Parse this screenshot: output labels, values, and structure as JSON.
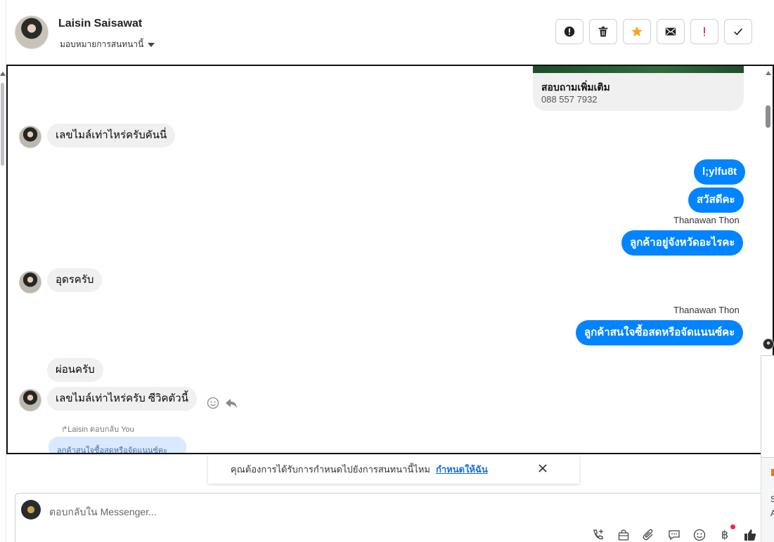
{
  "header": {
    "contact_name": "Laisin Saisawat",
    "assign_label": "มอบหมายการสนทนานี้"
  },
  "header_actions": [
    {
      "icon": "alert-circle-icon"
    },
    {
      "icon": "trash-icon"
    },
    {
      "icon": "star-icon",
      "color": "#f5a623"
    },
    {
      "icon": "mail-icon"
    },
    {
      "icon": "exclamation-icon",
      "color": "#e0245e"
    },
    {
      "icon": "check-icon"
    }
  ],
  "card": {
    "title": "สอบถามเพิ่มเติม",
    "phone": "088 557 7932"
  },
  "messages": {
    "m1": "เลขไมล์เท่าไหร่ครับคันนี่",
    "m2": "l;ylfu8t",
    "m3": "สวัสดีคะ",
    "m4_sender": "Thanawan Thon",
    "m4": "ลูกค้าอยู่จังหวัดอะไรคะ",
    "m5": "อุดรครับ",
    "m6_sender": "Thanawan Thon",
    "m6": "ลูกค้าสนใจซื้อสดหรือจัดแนนซ์คะ",
    "m7": "ผ่อนครับ",
    "m8": "เลขไมล์เท่าไหร่ครับ ซีวิคตัวนี้",
    "reply_note": "Laisin ตอบกลับ You",
    "quoted": "ลูกค้าสนใจซื้อสดหรือจัดแนนซ์คะ"
  },
  "notification": {
    "text": "คุณต้องการได้รับการกำหนดไปยังการสนทนานี้ไหม",
    "link": "กำหนดให้ฉัน"
  },
  "composer": {
    "placeholder": "ตอบกลับใน Messenger...",
    "baht_symbol": "฿"
  },
  "edge": {
    "s": "S",
    "a": "A"
  },
  "colors": {
    "outgoing_bubble": "#0084ff",
    "incoming_bubble": "#f0f0f0",
    "link": "#1a6ed8"
  }
}
